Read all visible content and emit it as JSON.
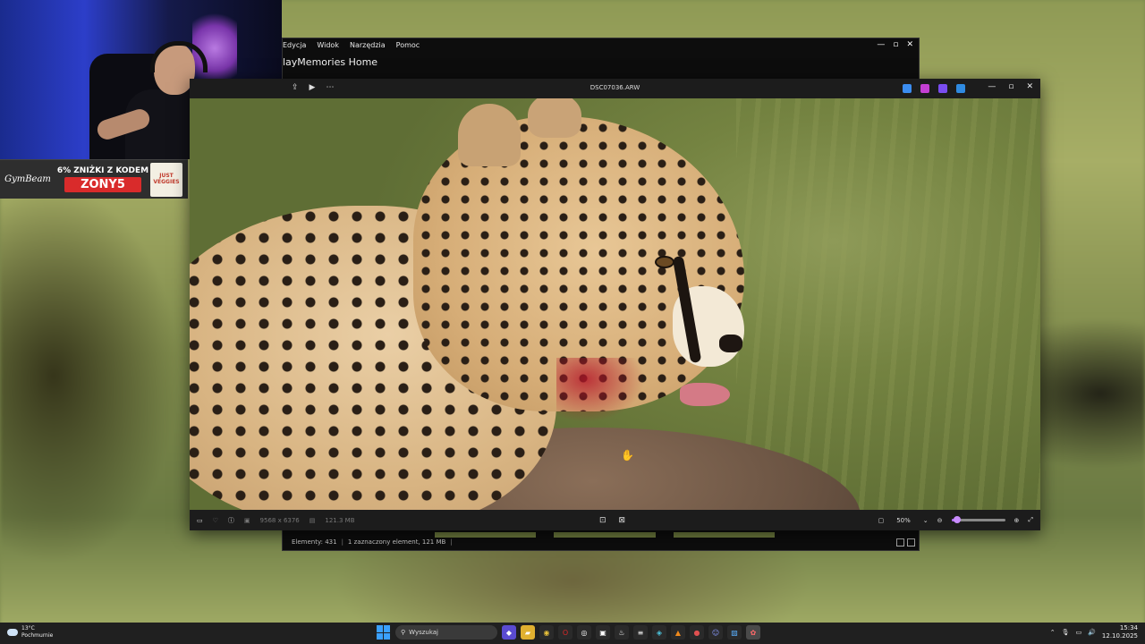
{
  "webcam": {
    "promo_brand": "GymBeam",
    "promo_deal": "6% ZNIŻKI Z KODEM",
    "promo_code": "ZONY5",
    "promo_product": "JUST VEGGIES"
  },
  "playmemories": {
    "menu": [
      "Edycja",
      "Widok",
      "Narzędzia",
      "Pomoc"
    ],
    "title": "layMemories Home",
    "status": {
      "elements": "Elementy: 431",
      "selected": "1 zaznaczony element, 121 MB"
    }
  },
  "viewer": {
    "filename": "DSC07036.ARW",
    "dimensions": "9568 x 6376",
    "filesize": "121.3 MB",
    "zoom": "50%",
    "zoom_level": 0.1
  },
  "taskbar": {
    "weather_temp": "13°C",
    "weather_desc": "Pochmurnie",
    "search_placeholder": "Wyszukaj",
    "time": "15:34",
    "date": "12.10.2025"
  },
  "colors": {
    "accent": "#b26bff",
    "taskbar_bg": "#202020",
    "viewer_bg": "#1c1c1c"
  }
}
